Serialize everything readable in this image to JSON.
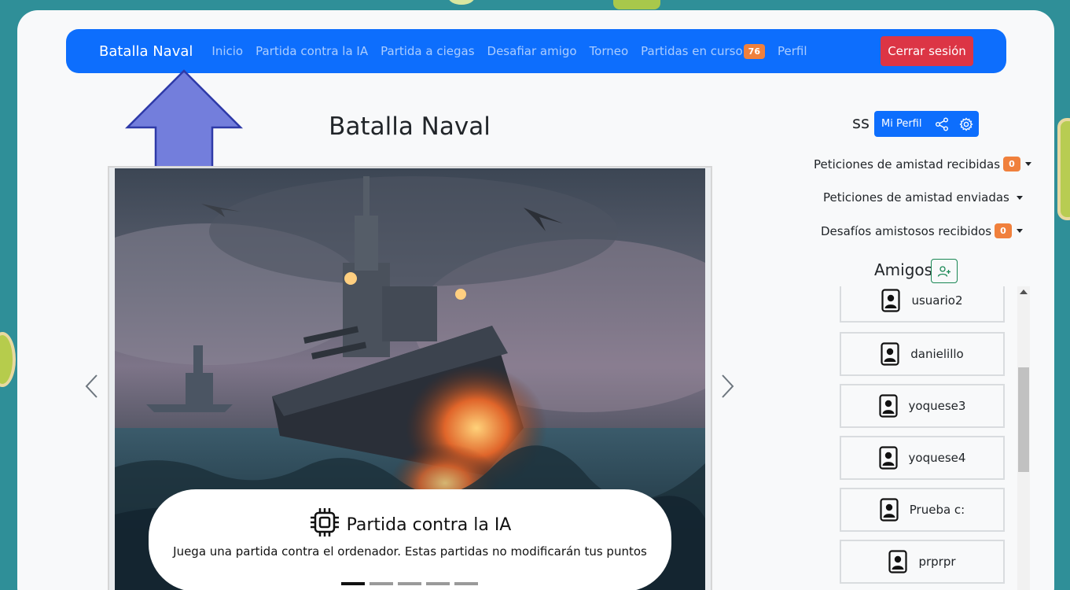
{
  "navbar": {
    "brand": "Batalla Naval",
    "links": [
      {
        "label": "Inicio"
      },
      {
        "label": "Partida contra la IA"
      },
      {
        "label": "Partida a ciegas"
      },
      {
        "label": "Desafiar amigo"
      },
      {
        "label": "Torneo"
      },
      {
        "label": "Partidas en curso",
        "badge": "76"
      },
      {
        "label": "Perfil"
      }
    ],
    "logout_label": "Cerrar sesión",
    "bg_color": "#0d6efd",
    "logout_color": "#dc3545"
  },
  "main": {
    "title": "Batalla Naval",
    "carousel": {
      "caption_title": "Partida contra la IA",
      "caption_icon": "cpu-icon",
      "caption_text": "Juega una partida contra el ordenador. Estas partidas no modificarán tus puntos",
      "indicator_count": 5,
      "active_index": 0
    }
  },
  "sidebar": {
    "username": "ss",
    "profile_button": "Mi Perfil",
    "dropdowns": [
      {
        "label": "Peticiones de amistad recibidas",
        "badge": "0"
      },
      {
        "label": "Peticiones de amistad enviadas"
      },
      {
        "label": "Desafíos amistosos recibidos",
        "badge": "0"
      }
    ],
    "friends_title": "Amigos",
    "friends": [
      {
        "name": "usuario2"
      },
      {
        "name": "danielillo"
      },
      {
        "name": "yoquese3"
      },
      {
        "name": "yoquese4"
      },
      {
        "name": "Prueba c:"
      },
      {
        "name": "prprpr"
      }
    ]
  },
  "colors": {
    "accent": "#0d6efd",
    "badge": "#f0803c",
    "annotation_arrow": "#5c68d6"
  }
}
